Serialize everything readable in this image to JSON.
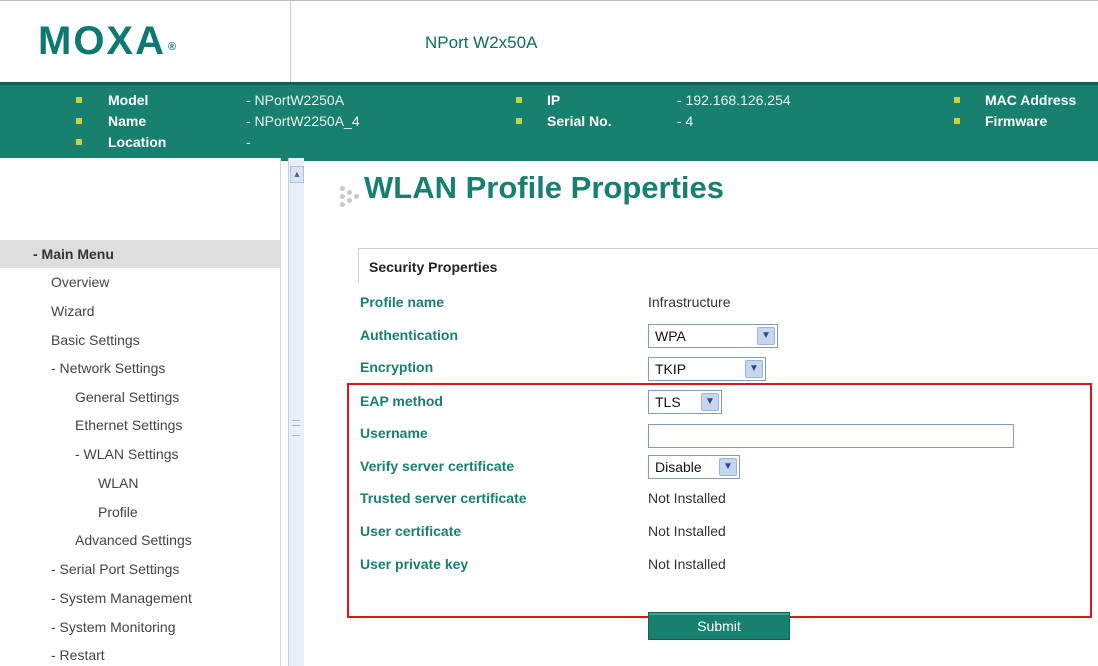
{
  "header": {
    "logo_text": "MOXA",
    "logo_mark": "®",
    "product": "NPort W2x50A"
  },
  "info": {
    "model_label": "Model",
    "model_value": "- NPortW2250A",
    "name_label": "Name",
    "name_value": "- NPortW2250A_4",
    "location_label": "Location",
    "location_value": "-",
    "ip_label": "IP",
    "ip_value": "- 192.168.126.254",
    "serial_label": "Serial No.",
    "serial_value": "- 4",
    "mac_label": "MAC Address",
    "firmware_label": "Firmware"
  },
  "menu": {
    "head": "- Main Menu",
    "items": [
      {
        "label": "Overview"
      },
      {
        "label": "Wizard"
      },
      {
        "label": "Basic Settings"
      },
      {
        "label": "- Network Settings"
      },
      {
        "label": "General Settings"
      },
      {
        "label": "Ethernet Settings"
      },
      {
        "label": "- WLAN Settings"
      },
      {
        "label": "WLAN"
      },
      {
        "label": "Profile"
      },
      {
        "label": "Advanced Settings"
      },
      {
        "label": "- Serial Port Settings"
      },
      {
        "label": "- System Management"
      },
      {
        "label": "- System Monitoring"
      },
      {
        "label": "- Restart"
      }
    ]
  },
  "page": {
    "title": "WLAN Profile Properties",
    "section": "Security Properties",
    "fields": {
      "profile_name_label": "Profile name",
      "profile_name_value": "Infrastructure",
      "authentication_label": "Authentication",
      "authentication_value": "WPA",
      "encryption_label": "Encryption",
      "encryption_value": "TKIP",
      "eap_label": "EAP method",
      "eap_value": "TLS",
      "username_label": "Username",
      "username_value": "",
      "verify_label": "Verify server certificate",
      "verify_value": "Disable",
      "trusted_label": "Trusted server certificate",
      "trusted_value": "Not Installed",
      "usercert_label": "User certificate",
      "usercert_value": "Not Installed",
      "privkey_label": "User private key",
      "privkey_value": "Not Installed"
    },
    "submit_label": "Submit"
  },
  "colors": {
    "brand": "#17806f",
    "highlight": "#e01616",
    "bullet": "#c8d23a"
  }
}
